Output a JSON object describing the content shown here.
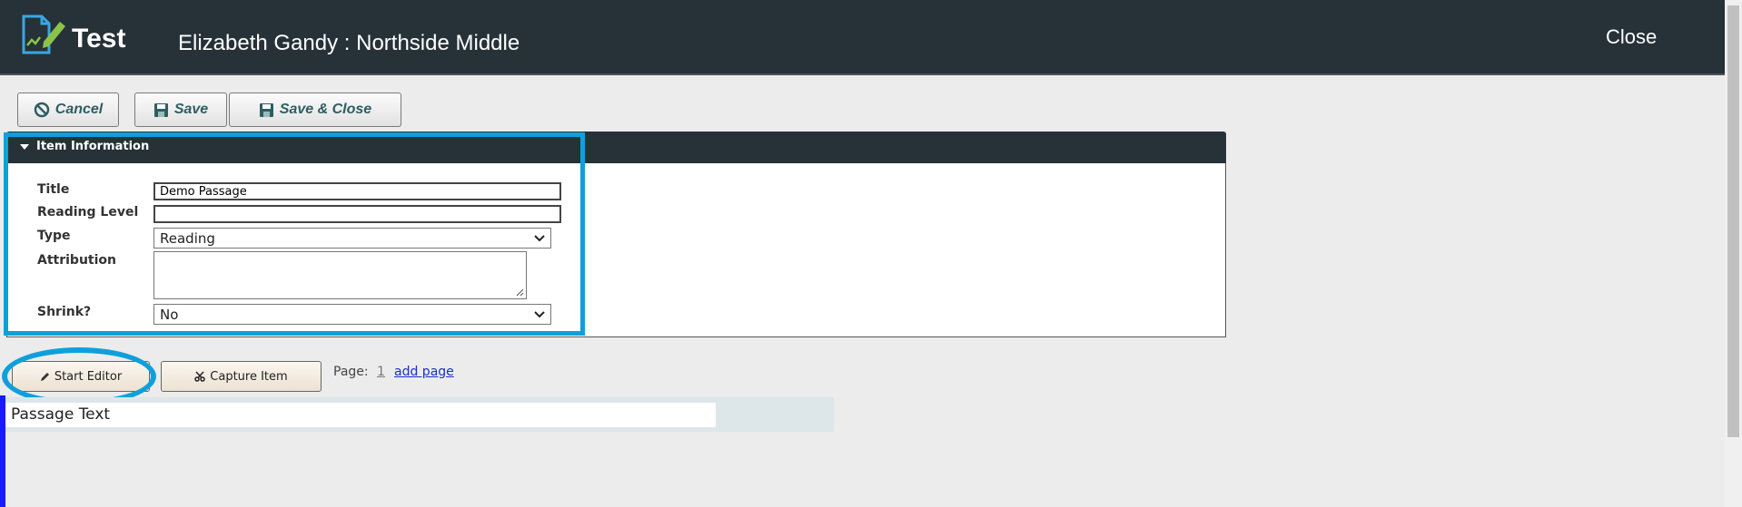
{
  "header": {
    "app_title": "Test",
    "page_heading": "Elizabeth Gandy : Northside Middle",
    "close_label": "Close"
  },
  "toolbar": {
    "cancel_label": "Cancel",
    "save_label": "Save",
    "save_close_label": "Save & Close"
  },
  "item_info": {
    "section_title": "Item Information",
    "fields": {
      "title_label": "Title",
      "title_value": "Demo Passage",
      "reading_level_label": "Reading Level",
      "reading_level_value": "",
      "type_label": "Type",
      "type_value": "Reading",
      "attribution_label": "Attribution",
      "attribution_value": "",
      "shrink_label": "Shrink?",
      "shrink_value": "No"
    }
  },
  "editor_controls": {
    "start_editor_label": "Start Editor",
    "capture_item_label": "Capture Item",
    "page_label": "Page:",
    "page_number": "1",
    "add_page_label": "add page"
  },
  "passage": {
    "text": "Passage Text"
  },
  "colors": {
    "header_bg": "#263238",
    "highlight": "#0ea0dc",
    "button_text": "#2e5e62",
    "link": "#1a2fcf"
  }
}
